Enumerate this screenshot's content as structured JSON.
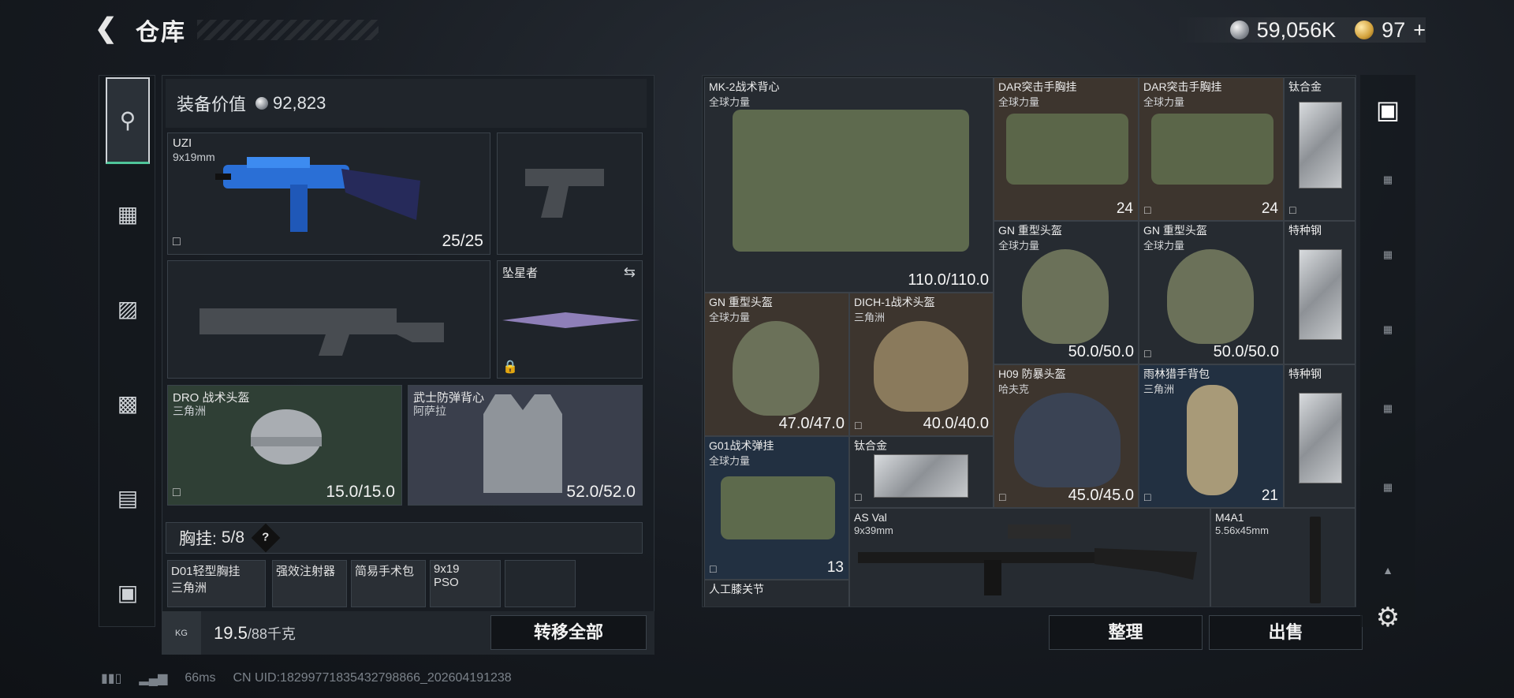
{
  "header": {
    "title": "仓库"
  },
  "currency": {
    "silver": "59,056K",
    "gold": "97",
    "gold_plus": "+"
  },
  "loadout": {
    "value_label": "装备价值",
    "value": "92,823",
    "primary": {
      "name": "UZI",
      "caliber": "9x19mm",
      "ammo": "25/25"
    },
    "melee": {
      "name": "坠星者"
    },
    "helmet": {
      "name": "DRO 战术头盔",
      "origin": "三角洲",
      "durability": "15.0/15.0"
    },
    "armor": {
      "name": "武士防弹背心",
      "origin": "阿萨拉",
      "durability": "52.0/52.0"
    },
    "chest_rig": {
      "label": "胸挂:",
      "capacity": "5/8"
    },
    "rig_items": [
      {
        "name": "D01轻型胸挂",
        "sub": "三角洲"
      },
      {
        "name": "强效注射器",
        "sub": ""
      },
      {
        "name": "简易手术包",
        "sub": ""
      },
      {
        "name": "9x19",
        "sub": "PSO"
      }
    ],
    "weight": "19.5",
    "weight_max": "/88千克",
    "transfer_all": "转移全部"
  },
  "storage": {
    "items": [
      {
        "name": "MK-2战术背心",
        "sub": "全球力量",
        "value": "110.0/110.0"
      },
      {
        "name": "DAR突击手胸挂",
        "sub": "全球力量",
        "value": "24"
      },
      {
        "name": "DAR突击手胸挂",
        "sub": "全球力量",
        "value": "24"
      },
      {
        "name": "钛合金",
        "sub": "",
        "value": ""
      },
      {
        "name": "GN 重型头盔",
        "sub": "全球力量",
        "value": "50.0/50.0"
      },
      {
        "name": "GN 重型头盔",
        "sub": "全球力量",
        "value": "50.0/50.0"
      },
      {
        "name": "特种钢",
        "sub": "",
        "value": ""
      },
      {
        "name": "GN 重型头盔",
        "sub": "全球力量",
        "value": "47.0/47.0"
      },
      {
        "name": "DICH-1战术头盔",
        "sub": "三角洲",
        "value": "40.0/40.0"
      },
      {
        "name": "H09 防暴头盔",
        "sub": "哈夫克",
        "value": "45.0/45.0"
      },
      {
        "name": "雨林猎手背包",
        "sub": "三角洲",
        "value": "21"
      },
      {
        "name": "特种钢",
        "sub": "",
        "value": ""
      },
      {
        "name": "G01战术弹挂",
        "sub": "全球力量",
        "value": "13"
      },
      {
        "name": "钛合金",
        "sub": "",
        "value": ""
      },
      {
        "name": "AS Val",
        "sub": "9x39mm",
        "value": ""
      },
      {
        "name": "M4A1",
        "sub": "5.56x45mm",
        "value": ""
      },
      {
        "name": "人工膝关节",
        "sub": "",
        "value": ""
      }
    ],
    "sort_button": "整理",
    "sell_button": "出售"
  },
  "status": {
    "ping": "66ms",
    "uid": "CN UID:18299771835432798866_202604191238"
  },
  "icons": [
    "back-icon",
    "pistol-icon",
    "vest-icon",
    "backpack-icon",
    "case-icon",
    "settings-icon"
  ]
}
